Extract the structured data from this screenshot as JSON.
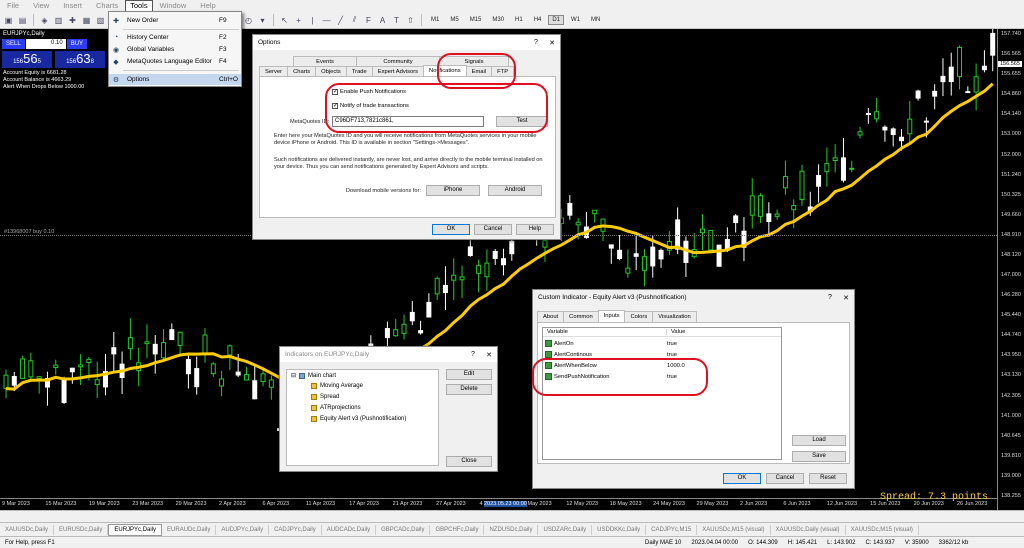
{
  "menu": {
    "items": [
      "File",
      "View",
      "Insert",
      "Charts",
      "Tools",
      "Window",
      "Help"
    ],
    "active_index": 4
  },
  "timeframes": [
    "M1",
    "M5",
    "M15",
    "M30",
    "H1",
    "H4",
    "D1",
    "W1",
    "MN"
  ],
  "selected_timeframe": "D1",
  "trade_panel": {
    "symbol": "EURJPYc,Daily",
    "sell": "SELL",
    "buy": "BUY",
    "lot": "0.10",
    "sell_prefix": "156",
    "sell_big": "56",
    "sell_sup": "5",
    "buy_prefix": "156",
    "buy_big": "63",
    "buy_sup": "8",
    "equity": "Account Equity is 6681.28",
    "balance": "Account Balance is 4663.29",
    "alert": "Alert When Drops Below 1000.00"
  },
  "order_label": "#13968007 buy 0.10",
  "spread_text": "Spread: 7.3 points",
  "price_axis": [
    "157.740",
    "156.565",
    "155.655",
    "154.860",
    "154.140",
    "153.000",
    "152.000",
    "151.240",
    "150.325",
    "149.660",
    "148.910",
    "148.120",
    "147.000",
    "146.280",
    "145.440",
    "144.740",
    "143.950",
    "143.130",
    "142.305",
    "141.000",
    "140.645",
    "139.810",
    "139.000",
    "138.255"
  ],
  "price_tag": "156.565",
  "date_axis": [
    "9 Mar 2023",
    "15 Mar 2023",
    "19 Mar 2023",
    "23 Mar 2023",
    "29 Mar 2023",
    "2 Apr 2023",
    "6 Apr 2023",
    "11 Apr 2023",
    "17 Apr 2023",
    "21 Apr 2023",
    "27 Apr 2023",
    "4 May 2023",
    "8 May 2023",
    "12 May 2023",
    "18 May 2023",
    "24 May 2023",
    "29 May 2023",
    "2 Jun 2023",
    "6 Jun 2023",
    "12 Jun 2023",
    "15 Jun 2023",
    "20 Jun 2023",
    "26 Jun 2023"
  ],
  "date_tag": "2023.05.23 00:00",
  "tools_menu": {
    "items": [
      {
        "icon": "new-order-icon",
        "label": "New Order",
        "shortcut": "F9"
      },
      {
        "icon": "history-center-icon",
        "label": "History Center",
        "shortcut": "F2"
      },
      {
        "icon": "global-variables-icon",
        "label": "Global Variables",
        "shortcut": "F3"
      },
      {
        "icon": "metaquotes-editor-icon",
        "label": "MetaQuotes Language Editor",
        "shortcut": "F4"
      },
      {
        "icon": "options-icon",
        "label": "Options",
        "shortcut": "Ctrl+O"
      }
    ]
  },
  "options": {
    "title": "Options",
    "tabs_top": [
      "Events",
      "Community",
      "Signals"
    ],
    "tabs_bottom": [
      "Server",
      "Charts",
      "Objects",
      "Trade",
      "Expert Advisors",
      "Notifications",
      "Email",
      "FTP"
    ],
    "enable_push": "Enable Push Notifications",
    "notify_trade": "Notify of trade transactions",
    "metaquotes_label": "MetaQuotes ID:",
    "metaquotes_value": "C96DF713,7821c861,",
    "test_btn": "Test",
    "desc1": "Enter here your MetaQuotes ID and you will receive notifications from MetaQuotes services in your mobile device iPhone or Android. This ID is available in section \"Settings->Messages\".",
    "desc2": "Such notifications are delivered instantly, are never lost, and arrive directly to the mobile terminal installed on your device. Thus you can send notifications generated by Expert Advisors and scripts.",
    "download_label": "Download mobile versions for:",
    "iphone": "iPhone",
    "android": "Android",
    "ok": "OK",
    "cancel": "Cancel",
    "help": "Help"
  },
  "indicators": {
    "title": "Indicators on EURJPYc,Daily",
    "tree": [
      "Main chart",
      "Moving Average",
      "Spread",
      "ATRprojections",
      "Equity Alert v3 (Pushnotification)"
    ],
    "edit": "Edit",
    "delete": "Delete",
    "close": "Close"
  },
  "custom": {
    "title": "Custom Indicator - Equity Alert v3 (Pushnotification)",
    "tabs": [
      "About",
      "Common",
      "Inputs",
      "Colors",
      "Visualization"
    ],
    "col_variable": "Variable",
    "col_value": "Value",
    "rows": [
      {
        "name": "AlertOn",
        "value": "true"
      },
      {
        "name": "AlertContinous",
        "value": "true"
      },
      {
        "name": "AlertWhenBelow",
        "value": "1000.0"
      },
      {
        "name": "SendPushNotification",
        "value": "true"
      }
    ],
    "load": "Load",
    "save": "Save",
    "ok": "OK",
    "cancel": "Cancel",
    "reset": "Reset"
  },
  "symbol_tabs": [
    "XAUUSDc,Daily",
    "EURUSDc,Daily",
    "EURJPYc,Daily",
    "EURAUDc,Daily",
    "AUDJPYc,Daily",
    "CADJPYc,Daily",
    "AUDCADc,Daily",
    "GBPCADc,Daily",
    "GBPCHFc,Daily",
    "NZDUSDc,Daily",
    "USDZARc,Daily",
    "USDDKKc,Daily",
    "CADJPYc,M15",
    "XAUUSDc,M15 (visual)",
    "XAUUSDc,Daily (visual)",
    "XAUUSDc,M15 (visual)"
  ],
  "selected_symbol_tab": 2,
  "status": {
    "help": "For Help, press F1",
    "profile": "Daily MAE 10",
    "datetime": "2023.04.04 00:00",
    "open": "O: 144.309",
    "high": "H: 145.421",
    "low": "L: 143.902",
    "close": "C: 143.937",
    "volume": "V: 35900",
    "traffic": "3362/12 kb"
  },
  "colors": {
    "bull": "#22cc22",
    "bear": "#ffffff",
    "ma": "#ffcc00",
    "highlight": "#e01020"
  }
}
